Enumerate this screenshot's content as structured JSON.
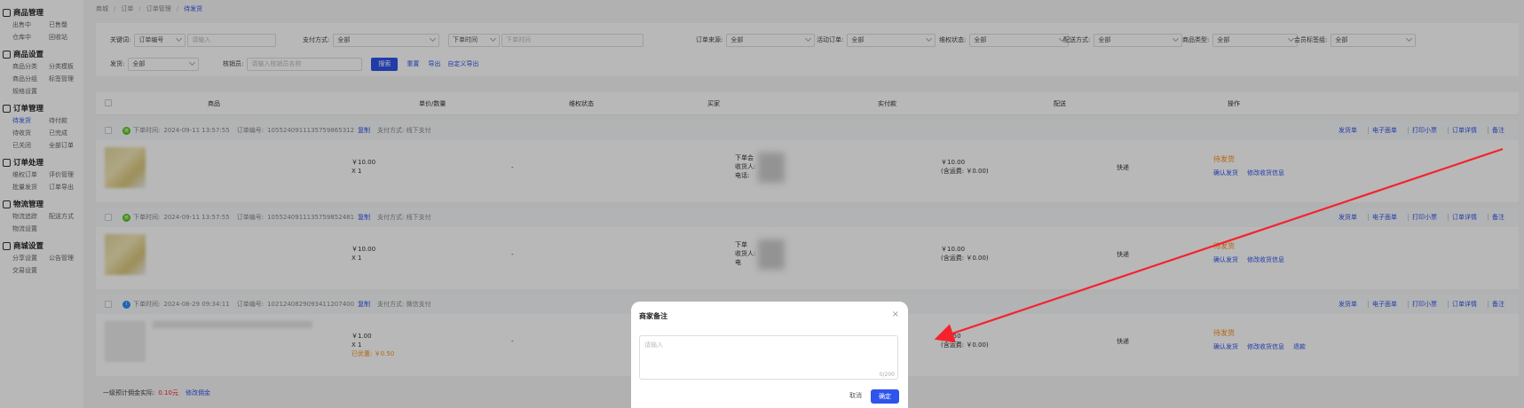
{
  "sidebar": {
    "groups": [
      {
        "title": "商品管理",
        "icon": "product-icon",
        "items": [
          "出售中",
          "已售罄",
          "仓库中",
          "回收站"
        ]
      },
      {
        "title": "商品设置",
        "icon": "settings-icon",
        "items": [
          "商品分类",
          "分类模板",
          "商品分组",
          "标签管理",
          "规格设置"
        ]
      },
      {
        "title": "订单管理",
        "icon": "order-icon",
        "items": [
          "待发货",
          "待付款",
          "待收货",
          "已完成",
          "已关闭",
          "全部订单"
        ]
      },
      {
        "title": "订单处理",
        "icon": "process-icon",
        "items": [
          "维权订单",
          "评价管理",
          "批量发货",
          "订单导出"
        ]
      },
      {
        "title": "物流管理",
        "icon": "truck-icon",
        "items": [
          "物流追踪",
          "配送方式",
          "物流设置"
        ]
      },
      {
        "title": "商城设置",
        "icon": "shop-icon",
        "items": [
          "分享设置",
          "公告管理",
          "交易设置"
        ]
      }
    ],
    "active_item": "待发货"
  },
  "breadcrumb": [
    "商城",
    "订单",
    "订单管理",
    "待发货"
  ],
  "filters": {
    "keyword_label": "关键词:",
    "keyword_select": "订单编号",
    "keyword_placeholder": "请输入",
    "pay_label": "支付方式:",
    "pay_value": "全部",
    "time_select": "下单时间",
    "time_placeholder": "下单时间",
    "source_label": "订单来源:",
    "source_value": "全部",
    "activity_label": "活动订单:",
    "activity_value": "全部",
    "rights_label": "维权状态:",
    "rights_value": "全部",
    "delivery_label": "配送方式:",
    "delivery_value": "全部",
    "goods_type_label": "商品类型:",
    "goods_type_value": "全部",
    "member_label": "会员标签组:",
    "member_value": "全部",
    "shipper_label": "发货:",
    "shipper_value": "全部",
    "remark_label": "核销员:",
    "remark_placeholder": "请输入核销员名称",
    "search_btn": "搜索",
    "reset_link": "重置",
    "export_link": "导出",
    "custom_export_link": "自定义导出"
  },
  "table": {
    "headers": [
      "商品",
      "单价/数量",
      "维权状态",
      "买家",
      "实付款",
      "配送",
      "操作"
    ],
    "ops": [
      "发货单",
      "电子面单",
      "打印小票",
      "订单详情",
      "备注"
    ],
    "orders": [
      {
        "time_label": "下单时间:",
        "time": "2024-09-11 13:57:55",
        "no_label": "订单编号:",
        "no": "1055240911135759865312",
        "copy": "复制",
        "pay": "支付方式: 线下支付",
        "badge": "微",
        "price": "￥10.00",
        "qty": "X 1",
        "discount": "",
        "rights": "-",
        "buyer": [
          "下单会",
          "收货人:",
          "电话:"
        ],
        "paid": "￥10.00",
        "freight": "(含运费: ￥0.00)",
        "delivery": "快递",
        "status": "待发货",
        "actions": [
          "确认发货",
          "修改收货信息"
        ]
      },
      {
        "time_label": "下单时间:",
        "time": "2024-09-11 13:57:55",
        "no_label": "订单编号:",
        "no": "1055240911135759852481",
        "copy": "复制",
        "pay": "支付方式: 线下支付",
        "badge": "微",
        "price": "￥10.00",
        "qty": "X 1",
        "discount": "",
        "rights": "-",
        "buyer": [
          "下单",
          "收货人:",
          "电"
        ],
        "paid": "￥10.00",
        "freight": "(含运费: ￥0.00)",
        "delivery": "快递",
        "status": "待发货",
        "actions": [
          "确认发货",
          "修改收货信息"
        ]
      },
      {
        "time_label": "下单时间:",
        "time": "2024-08-29 09:34:11",
        "no_label": "订单编号:",
        "no": "1021240829093411207400",
        "copy": "复制",
        "pay": "支付方式: 微信支付",
        "badge": "i",
        "price": "￥1.00",
        "qty": "X 1",
        "discount": "已优惠: ￥0.50",
        "rights": "-",
        "buyer": [],
        "paid": "￥0.50",
        "freight": "(含运费: ￥0.00)",
        "delivery": "快递",
        "status": "待发货",
        "actions": [
          "确认发货",
          "修改收货信息",
          "退款"
        ]
      }
    ]
  },
  "footer": {
    "label": "一级预计佣金实际:",
    "amount": "0.10元",
    "link": "修改佣金"
  },
  "modal": {
    "title": "商家备注",
    "placeholder": "请输入",
    "count": "0/200",
    "cancel": "取消",
    "ok": "确定"
  },
  "colors": {
    "accent": "#2f54eb",
    "pending": "#fa8c16",
    "arrow": "#f5222d"
  }
}
